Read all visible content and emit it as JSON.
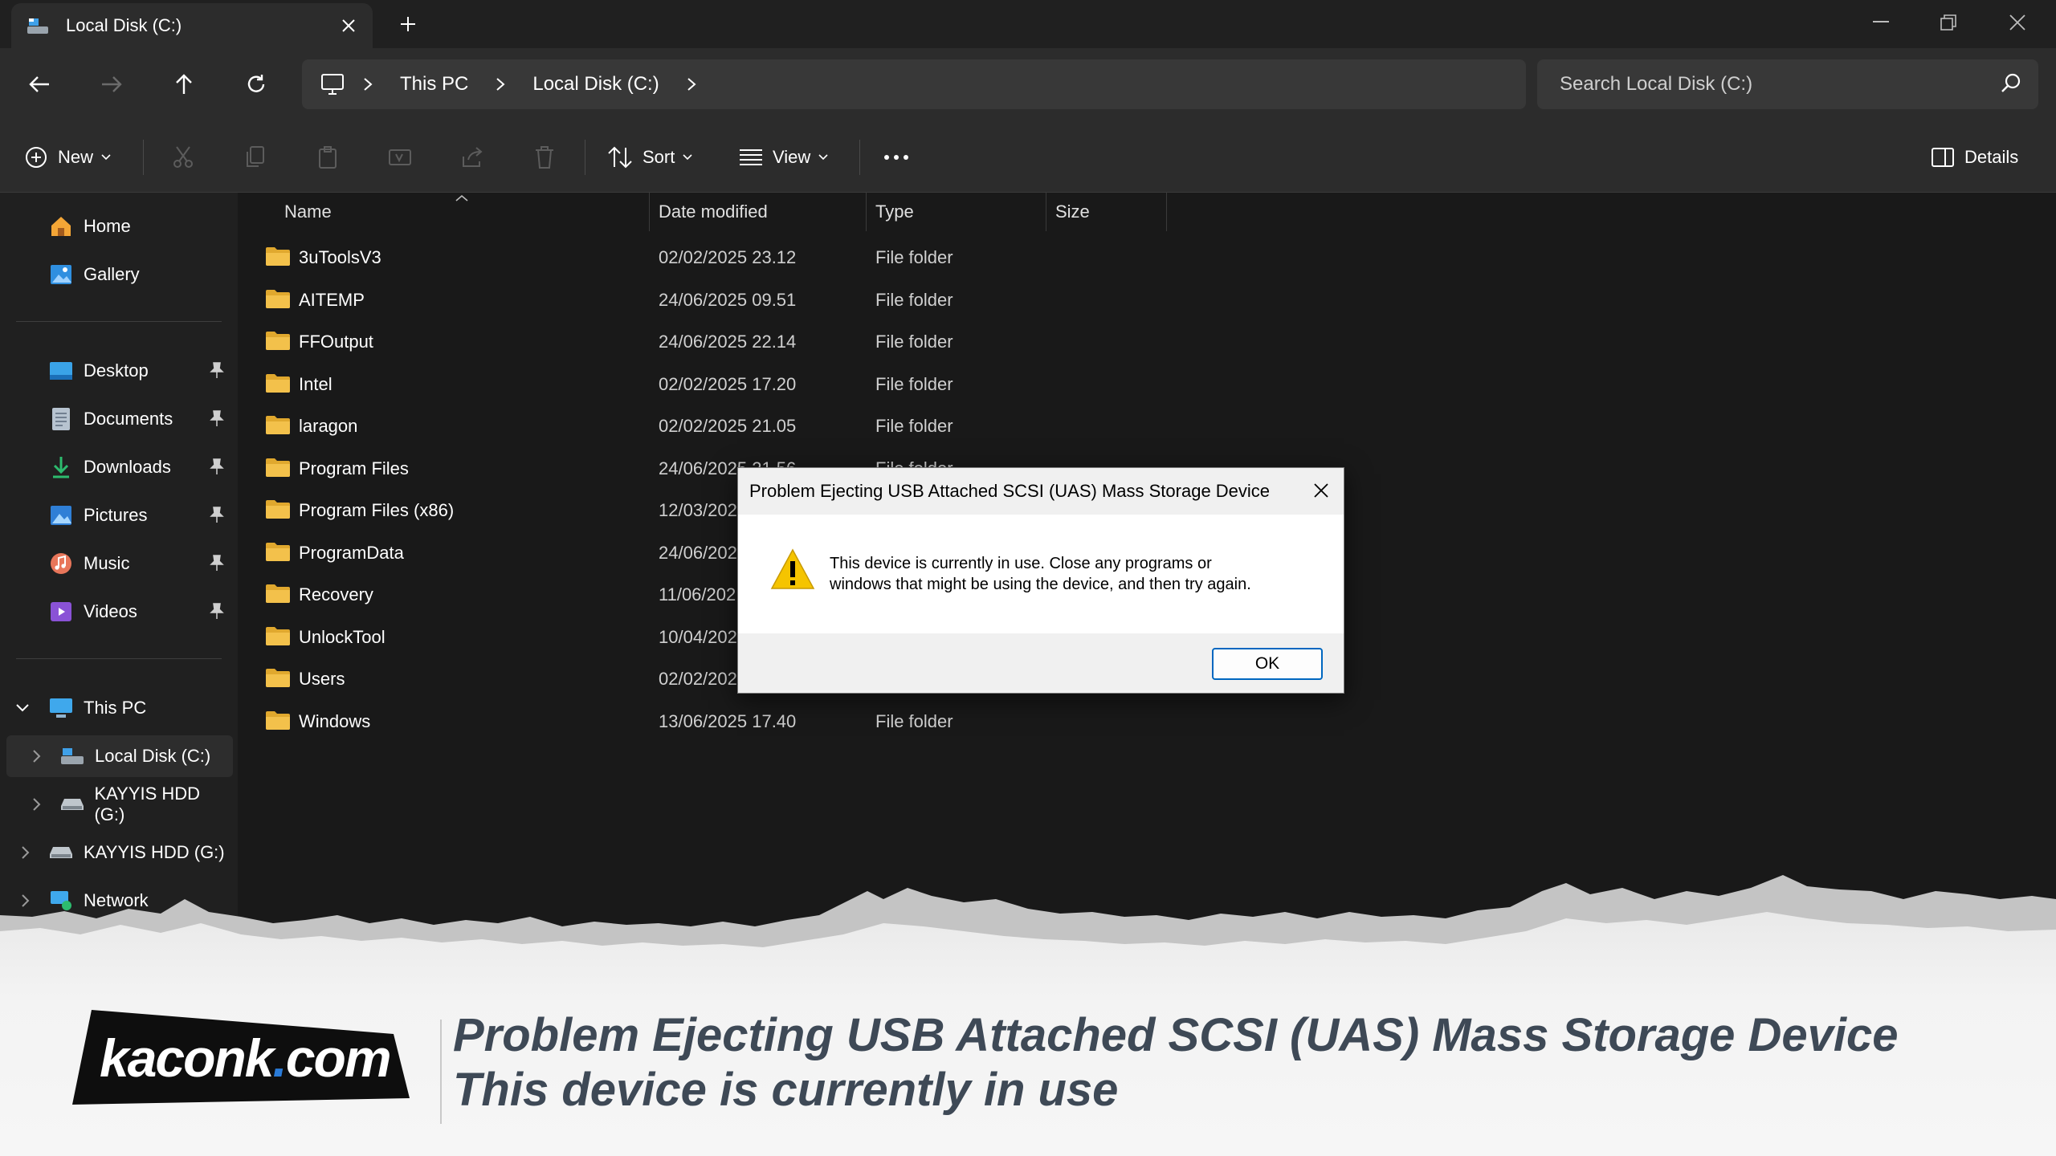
{
  "window": {
    "tab_title": "Local Disk (C:)"
  },
  "breadcrumb": [
    "This PC",
    "Local Disk (C:)"
  ],
  "search": {
    "placeholder": "Search Local Disk (C:)"
  },
  "toolbar": {
    "new_label": "New",
    "sort_label": "Sort",
    "view_label": "View",
    "details_label": "Details"
  },
  "sidebar": {
    "home": "Home",
    "gallery": "Gallery",
    "quick_access": [
      {
        "label": "Desktop"
      },
      {
        "label": "Documents"
      },
      {
        "label": "Downloads"
      },
      {
        "label": "Pictures"
      },
      {
        "label": "Music"
      },
      {
        "label": "Videos"
      }
    ],
    "this_pc": "This PC",
    "drives": [
      {
        "label": "Local Disk (C:)"
      },
      {
        "label": "KAYYIS HDD (G:)"
      }
    ],
    "kayyis_root": "KAYYIS HDD (G:)",
    "network": "Network"
  },
  "columns": {
    "name": "Name",
    "date": "Date modified",
    "type": "Type",
    "size": "Size"
  },
  "files": [
    {
      "name": "3uToolsV3",
      "date": "02/02/2025 23.12",
      "type": "File folder"
    },
    {
      "name": "AITEMP",
      "date": "24/06/2025 09.51",
      "type": "File folder"
    },
    {
      "name": "FFOutput",
      "date": "24/06/2025 22.14",
      "type": "File folder"
    },
    {
      "name": "Intel",
      "date": "02/02/2025 17.20",
      "type": "File folder"
    },
    {
      "name": "laragon",
      "date": "02/02/2025 21.05",
      "type": "File folder"
    },
    {
      "name": "Program Files",
      "date": "24/06/2025 21.56",
      "type": "File folder"
    },
    {
      "name": "Program Files (x86)",
      "date": "12/03/202",
      "type": ""
    },
    {
      "name": "ProgramData",
      "date": "24/06/202",
      "type": ""
    },
    {
      "name": "Recovery",
      "date": "11/06/202",
      "type": ""
    },
    {
      "name": "UnlockTool",
      "date": "10/04/202",
      "type": ""
    },
    {
      "name": "Users",
      "date": "02/02/202",
      "type": ""
    },
    {
      "name": "Windows",
      "date": "13/06/2025 17.40",
      "type": "File folder"
    }
  ],
  "dialog": {
    "title": "Problem Ejecting USB Attached SCSI (UAS) Mass Storage Device",
    "message_line1": "This device is currently in use. Close any programs or",
    "message_line2": "windows that might be using the device, and then try again.",
    "ok_label": "OK"
  },
  "banner": {
    "logo_main": "kaconk",
    "logo_dot": ".",
    "logo_tld": "com",
    "headline_line1": "Problem Ejecting USB Attached SCSI (UAS) Mass Storage Device",
    "headline_line2": "This device is currently in use"
  },
  "colors": {
    "folder": "#f3c14b",
    "accent": "#0067c0",
    "warning": "#f5c400",
    "headline": "#3e4956"
  }
}
